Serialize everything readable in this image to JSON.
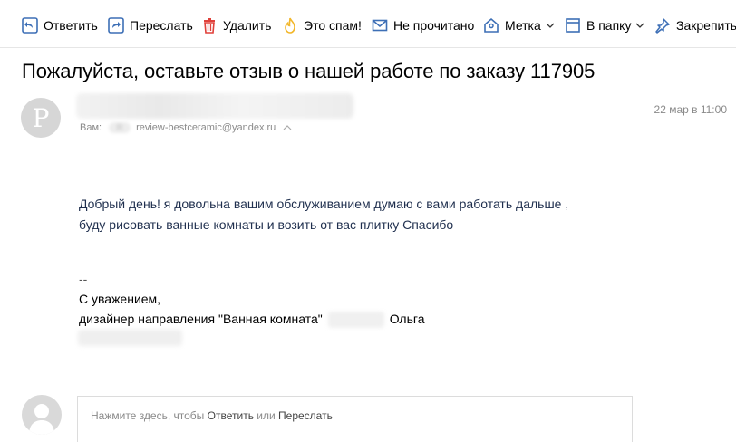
{
  "toolbar": {
    "reply": "Ответить",
    "forward": "Переслать",
    "delete": "Удалить",
    "spam": "Это спам!",
    "unread": "Не прочитано",
    "label": "Метка",
    "to_folder": "В папку",
    "pin": "Закрепить"
  },
  "message": {
    "subject": "Пожалуйста, оставьте отзыв о нашей работе по заказу 117905",
    "avatar_letter": "Р",
    "to_label": "Вам:",
    "to_avatar_letter": "R",
    "from_email": "review-bestceramic@yandex.ru",
    "date": "22 мар в 11:00",
    "body_line1": "Добрый день! я довольна вашим обслуживанием думаю с вами работать дальше ,",
    "body_line2": "буду рисовать ванные комнаты и возить от вас плитку Спасибо",
    "sig_dashes": "--",
    "sig_regards": "С уважением,",
    "sig_title": "дизайнер направления \"Ванная комната\"",
    "sig_name": "Ольга"
  },
  "reply": {
    "prefix": "Нажмите здесь, чтобы ",
    "reply_link": "Ответить",
    "or": " или ",
    "forward_link": "Переслать"
  },
  "colors": {
    "icon_blue": "#3d6fb6",
    "delete_red": "#e0403a",
    "spam_yellow": "#f2b72b",
    "body_text": "#1f2f4e"
  }
}
